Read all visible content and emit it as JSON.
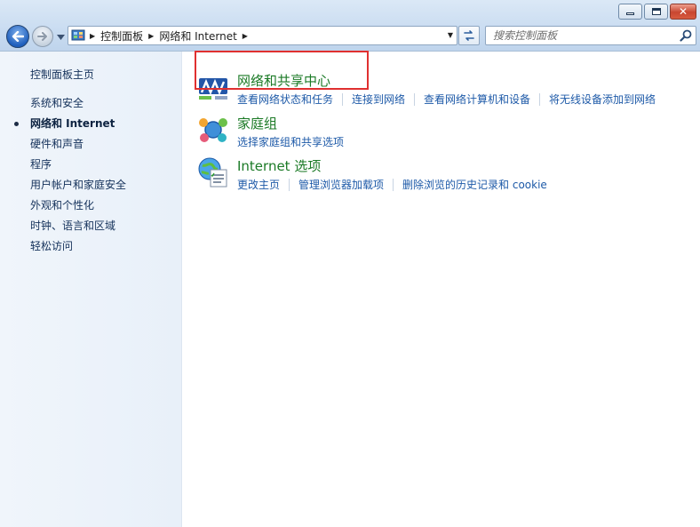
{
  "window": {
    "controls": {
      "minimize_icon": "minimize-icon",
      "maximize_icon": "maximize-icon",
      "close_icon": "close-icon",
      "close_color": "#c84630"
    }
  },
  "toolbar": {
    "back_icon": "back-arrow-icon",
    "forward_icon": "forward-arrow-icon",
    "recent_icon": "chevron-down-icon",
    "refresh_icon": "refresh-icon"
  },
  "address_bar": {
    "icon": "control-panel-icon",
    "breadcrumbs": [
      {
        "label": "控制面板"
      },
      {
        "label": "网络和 Internet"
      }
    ]
  },
  "search": {
    "placeholder": "搜索控制面板",
    "icon": "search-icon"
  },
  "sidebar": {
    "home_label": "控制面板主页",
    "items": [
      {
        "label": "系统和安全",
        "current": false
      },
      {
        "label": "网络和 Internet",
        "current": true
      },
      {
        "label": "硬件和声音",
        "current": false
      },
      {
        "label": "程序",
        "current": false
      },
      {
        "label": "用户帐户和家庭安全",
        "current": false
      },
      {
        "label": "外观和个性化",
        "current": false
      },
      {
        "label": "时钟、语言和区域",
        "current": false
      },
      {
        "label": "轻松访问",
        "current": false
      }
    ]
  },
  "main": {
    "categories": [
      {
        "icon": "network-sharing-center-icon",
        "title": "网络和共享中心",
        "links": [
          "查看网络状态和任务",
          "连接到网络",
          "查看网络计算机和设备",
          "将无线设备添加到网络"
        ]
      },
      {
        "icon": "homegroup-icon",
        "title": "家庭组",
        "links": [
          "选择家庭组和共享选项"
        ]
      },
      {
        "icon": "internet-options-icon",
        "title": "Internet 选项",
        "links": [
          "更改主页",
          "管理浏览器加载项",
          "删除浏览的历史记录和 cookie"
        ]
      }
    ],
    "highlight_color": "#e03030"
  },
  "colors": {
    "link": "#1e5aa8",
    "category_title": "#1b7a26",
    "sidebar_bg": "#eef4fb"
  }
}
